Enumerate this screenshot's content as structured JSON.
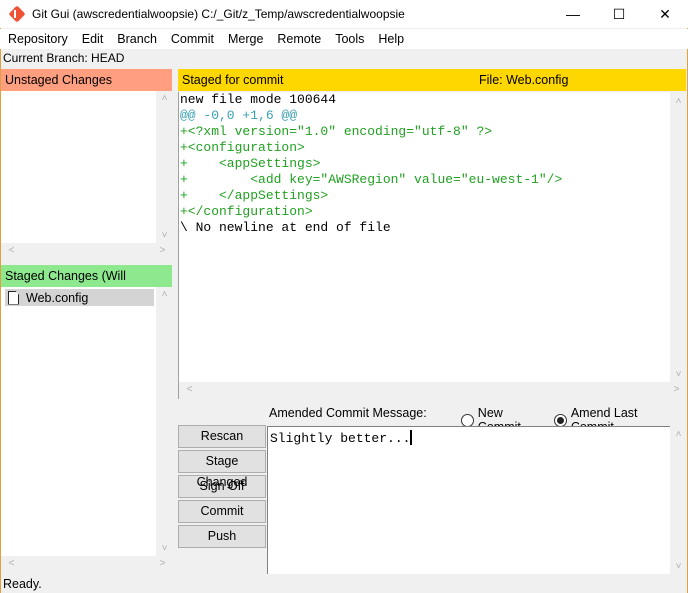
{
  "window": {
    "title": "Git Gui (awscredentialwoopsie) C:/_Git/z_Temp/awscredentialwoopsie",
    "controls": {
      "minimize": "—",
      "maximize": "☐",
      "close": "✕"
    }
  },
  "menu": [
    {
      "label": "Repository"
    },
    {
      "label": "Edit"
    },
    {
      "label": "Branch"
    },
    {
      "label": "Commit"
    },
    {
      "label": "Merge"
    },
    {
      "label": "Remote"
    },
    {
      "label": "Tools"
    },
    {
      "label": "Help"
    }
  ],
  "branch": {
    "text": "Current Branch: HEAD"
  },
  "unstaged": {
    "header": "Unstaged Changes",
    "files": []
  },
  "staged": {
    "header": "Staged Changes (Will Commit)",
    "files": [
      {
        "name": "Web.config",
        "icon": "file-icon",
        "selected": true
      }
    ]
  },
  "diff": {
    "header_left": "Staged for commit",
    "header_right": "File:  Web.config",
    "lines": [
      {
        "text": "new file mode 100644",
        "kind": "meta"
      },
      {
        "text": "@@ -0,0 +1,6 @@",
        "kind": "hunk"
      },
      {
        "text": "+<?xml version=\"1.0\" encoding=\"utf-8\" ?>",
        "kind": "add"
      },
      {
        "text": "+<configuration>",
        "kind": "add"
      },
      {
        "text": "+    <appSettings>",
        "kind": "add"
      },
      {
        "text": "+        <add key=\"AWSRegion\" value=\"eu-west-1\"/>",
        "kind": "add"
      },
      {
        "text": "+    </appSettings>",
        "kind": "add"
      },
      {
        "text": "+</configuration>",
        "kind": "add"
      },
      {
        "text": "\\ No newline at end of file",
        "kind": "meta"
      }
    ]
  },
  "commit": {
    "message_label": "Amended Commit Message:",
    "message": "Slightly better...",
    "radio_new": "New Commit",
    "radio_amend": "Amend Last Commit",
    "selected_mode": "amend",
    "buttons": {
      "rescan": "Rescan",
      "stage_changed": "Stage Changed",
      "sign_off": "Sign Off",
      "commit": "Commit",
      "push": "Push"
    }
  },
  "colors": {
    "unstaged_header": "#ff9f7f",
    "staged_header": "#8ee88e",
    "diff_header": "#ffd700",
    "diff_add": "#22a022",
    "diff_hunk": "#3aa0b0"
  },
  "status": {
    "text": "Ready."
  },
  "scroll_arrows": {
    "up": "˄",
    "down": "˅",
    "left": "<",
    "right": ">"
  }
}
